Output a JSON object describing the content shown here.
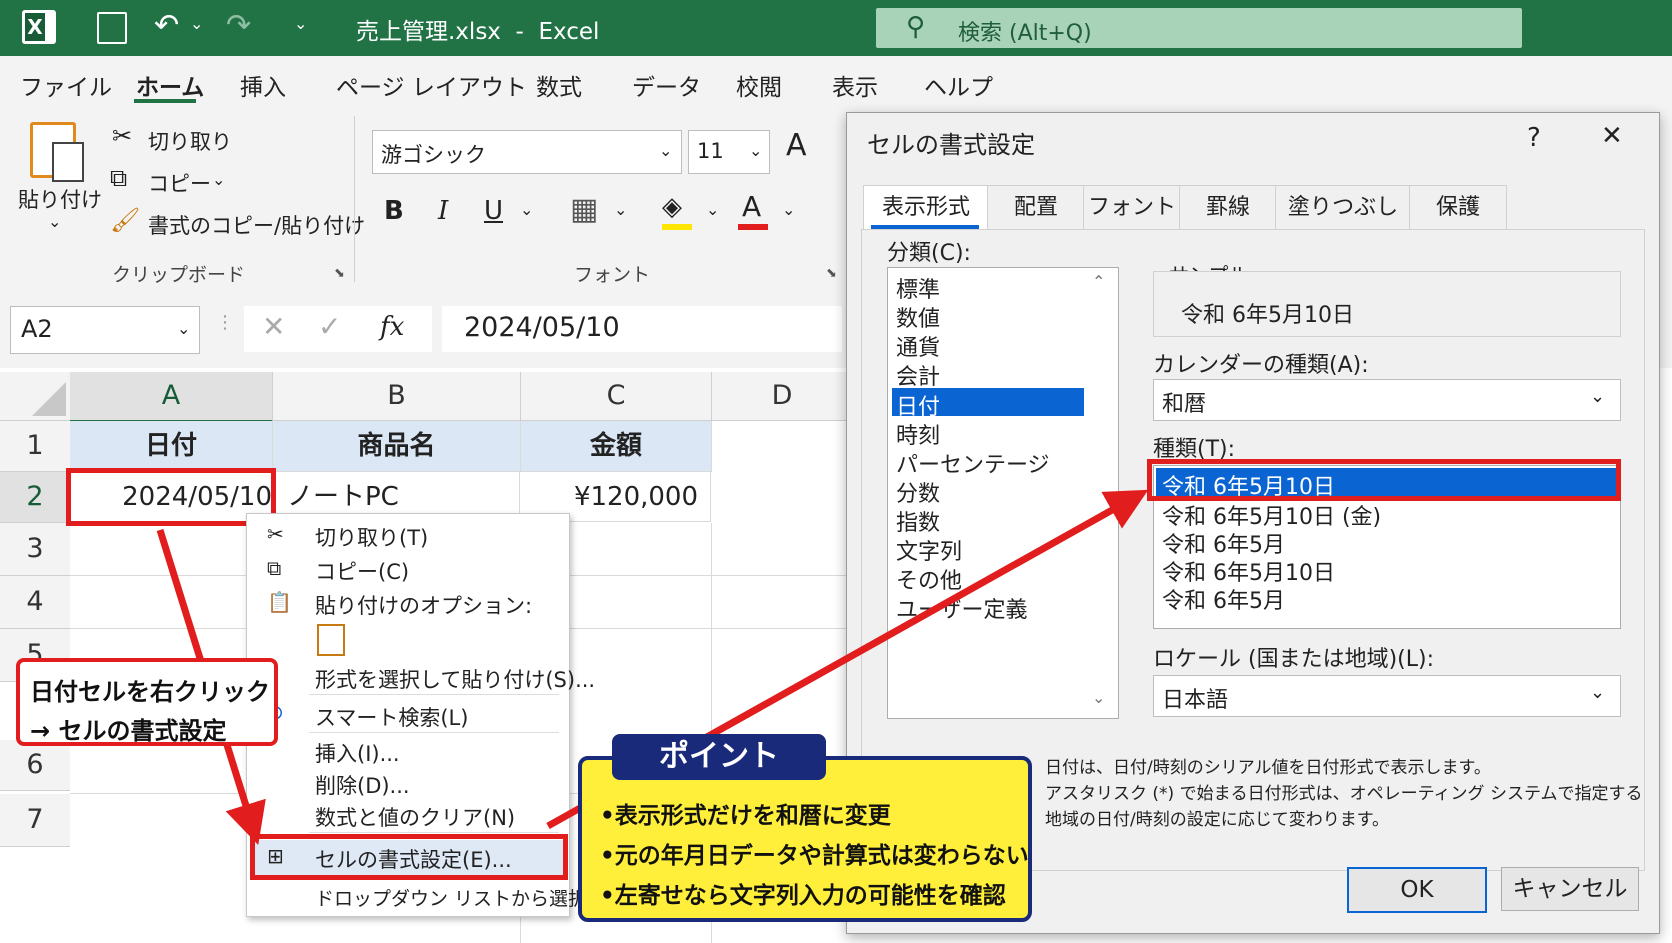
{
  "titlebar": {
    "app_icon": "excel-icon",
    "title": "売上管理.xlsx  -  Excel",
    "search_placeholder": "検索 (Alt+Q)"
  },
  "menu": [
    "ファイル",
    "ホーム",
    "挿入",
    "ページ レイアウト",
    "数式",
    "データ",
    "校閲",
    "表示",
    "ヘルプ"
  ],
  "active_menu": "ホーム",
  "ribbon": {
    "paste": "貼り付け",
    "cut": "切り取り",
    "copy": "コピー",
    "format_painter": "書式のコピー/貼り付け",
    "clipboard_group": "クリップボード",
    "font_name": "游ゴシック",
    "font_size": "11",
    "bold": "B",
    "italic": "I",
    "underline": "U",
    "font_color_letter": "A",
    "grow_font": "A",
    "font_group": "フォント"
  },
  "formula_bar": {
    "name_box": "A2",
    "fx": "fx",
    "value": "2024/05/10"
  },
  "grid": {
    "columns": [
      "A",
      "B",
      "C",
      "D"
    ],
    "rows": [
      "1",
      "2",
      "3",
      "4",
      "5",
      "6",
      "7"
    ],
    "header_row": [
      "日付",
      "商品名",
      "金額"
    ],
    "row2": [
      "2024/05/10",
      "ノートPC",
      "¥120,000"
    ]
  },
  "context_menu": {
    "items": [
      "切り取り(T)",
      "コピー(C)",
      "貼り付けのオプション:",
      "形式を選択して貼り付け(S)...",
      "スマート検索(L)",
      "挿入(I)...",
      "削除(D)...",
      "数式と値のクリア(N)",
      "セルの書式設定(E)...",
      "ドロップダウン リストから選択(K)..."
    ]
  },
  "callout": {
    "line1": "日付セルを右クリック",
    "line2": "→ セルの書式設定"
  },
  "point": {
    "header": "ポイント",
    "lines": [
      "•表示形式だけを和暦に変更",
      "•元の年月日データや計算式は変わらない",
      "•左寄せなら文字列入力の可能性を確認"
    ]
  },
  "dialog": {
    "title": "セルの書式設定",
    "help": "?",
    "close": "✕",
    "tabs": [
      "表示形式",
      "配置",
      "フォント",
      "罫線",
      "塗りつぶし",
      "保護"
    ],
    "category_label": "分類(C):",
    "categories": [
      "標準",
      "数値",
      "通貨",
      "会計",
      "日付",
      "時刻",
      "パーセンテージ",
      "分数",
      "指数",
      "文字列",
      "その他",
      "ユーザー定義"
    ],
    "selected_category": "日付",
    "sample_label": "サンプル",
    "sample_value": "令和 6年5月10日",
    "calendar_label": "カレンダーの種類(A):",
    "calendar_value": "和暦",
    "type_label": "種類(T):",
    "types": [
      "令和 6年5月10日",
      "令和 6年5月10日 (金)",
      "令和 6年5月",
      "令和 6年5月10日",
      "令和 6年5月"
    ],
    "locale_label": "ロケール (国または地域)(L):",
    "locale_value": "日本語",
    "description": [
      "日付は、日付/時刻のシリアル値を日付形式で表示します。",
      "アスタリスク (*) で始まる日付形式は、オペレーティング システムで指定する",
      "地域の日付/時刻の設定に応じて変わります。"
    ],
    "ok": "OK",
    "cancel": "キャンセル"
  },
  "colors": {
    "excel_green": "#217346",
    "highlight": "#e11d1d",
    "selection": "#0a64d2",
    "point_bg": "#ffef3a",
    "point_border": "#1a2a7a"
  }
}
